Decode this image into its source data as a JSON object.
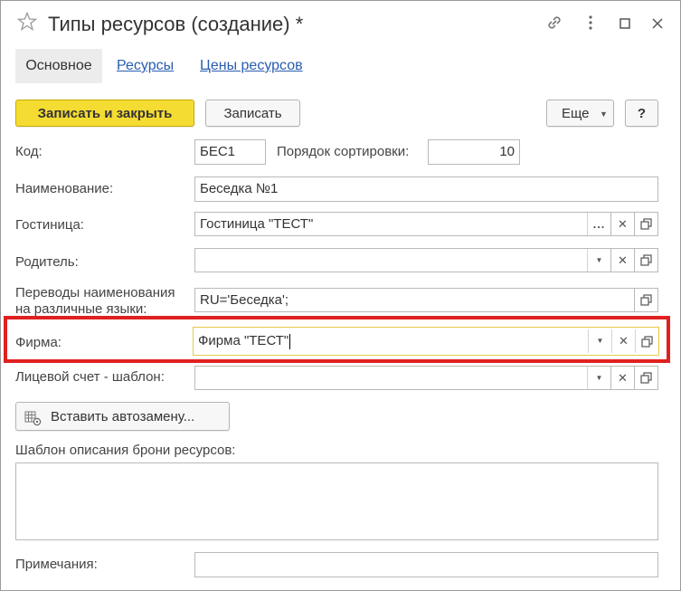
{
  "window": {
    "title": "Типы ресурсов (создание) *"
  },
  "tabs": {
    "main": "Основное",
    "resources": "Ресурсы",
    "prices": "Цены ресурсов"
  },
  "toolbar": {
    "save_close": "Записать и закрыть",
    "save": "Записать",
    "more": "Еще",
    "help": "?"
  },
  "form": {
    "code_label": "Код:",
    "code_value": "БЕС1",
    "sort_label": "Порядок сортировки:",
    "sort_value": "10",
    "name_label": "Наименование:",
    "name_value": "Беседка №1",
    "hotel_label": "Гостиница:",
    "hotel_value": "Гостиница \"ТЕСТ\"",
    "parent_label": "Родитель:",
    "parent_value": "",
    "translations_label_1": "Переводы наименования",
    "translations_label_2": "на различные языки:",
    "translations_value": "RU='Беседка';",
    "firm_label": "Фирма:",
    "firm_value": "Фирма \"ТЕСТ\"",
    "account_label": "Лицевой счет - шаблон:",
    "account_value": "",
    "insert_button": "Вставить автозамену...",
    "template_label": "Шаблон описания брони ресурсов:",
    "notes_label": "Примечания:",
    "notes_value": ""
  },
  "colors": {
    "primary_button": "#f5dc32",
    "link": "#2a5db0",
    "highlight": "#e02020"
  }
}
